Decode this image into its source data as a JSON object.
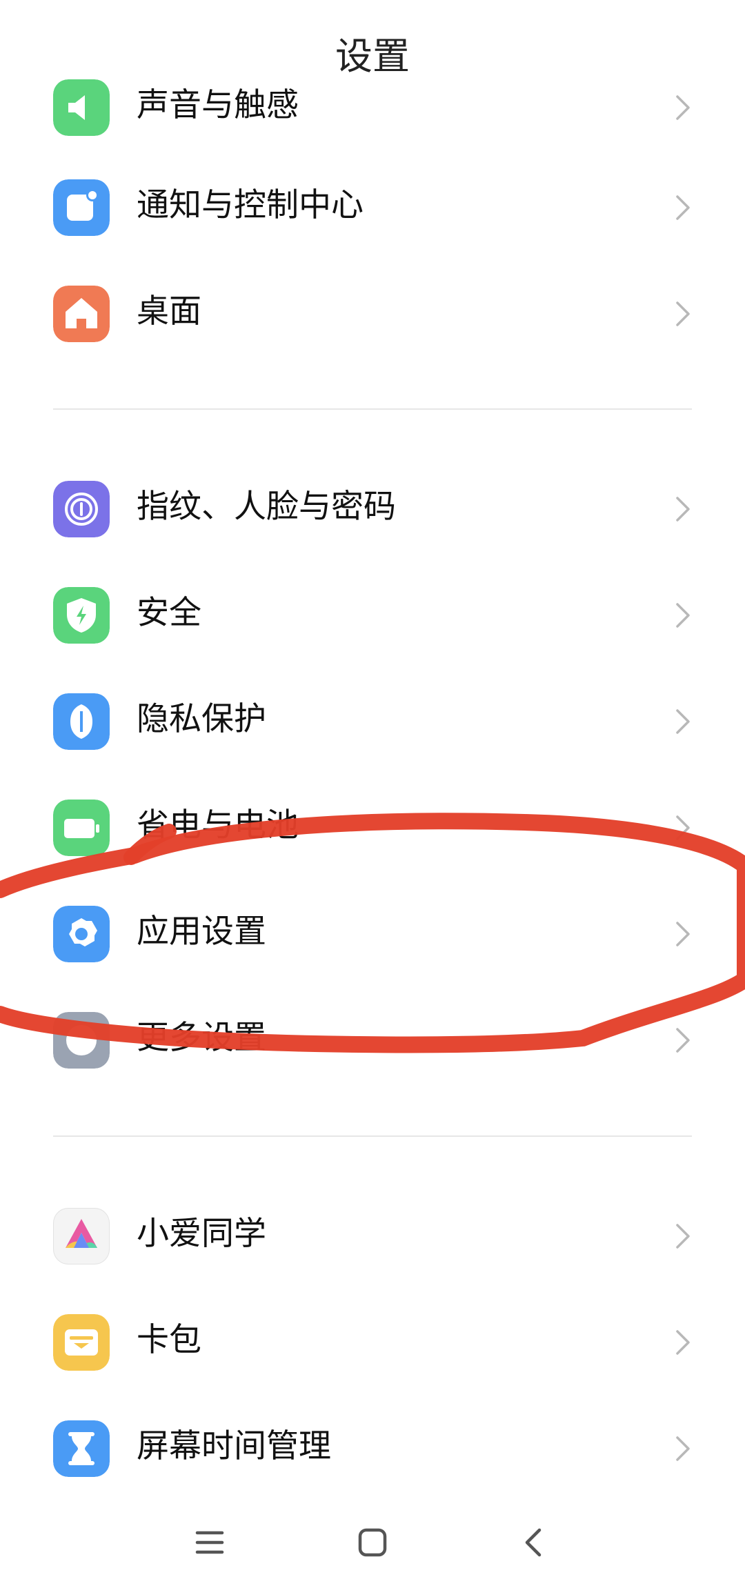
{
  "header": {
    "title": "设置"
  },
  "sections": [
    {
      "items": [
        {
          "id": "sound",
          "label": "声音与触感",
          "icon": "sound-icon",
          "color": "#5ad47c"
        },
        {
          "id": "notification",
          "label": "通知与控制中心",
          "icon": "notification-icon",
          "color": "#4a9bf5"
        },
        {
          "id": "desktop",
          "label": "桌面",
          "icon": "home-icon",
          "color": "#f07a54"
        }
      ]
    },
    {
      "items": [
        {
          "id": "fingerprint",
          "label": "指纹、人脸与密码",
          "icon": "fingerprint-icon",
          "color": "#7b72e8"
        },
        {
          "id": "security",
          "label": "安全",
          "icon": "shield-icon",
          "color": "#5ad47c"
        },
        {
          "id": "privacy",
          "label": "隐私保护",
          "icon": "privacy-icon",
          "color": "#4a9bf5"
        },
        {
          "id": "battery",
          "label": "省电与电池",
          "icon": "battery-icon",
          "color": "#5ad47c"
        },
        {
          "id": "app_settings",
          "label": "应用设置",
          "icon": "gear-icon",
          "color": "#4a9bf5"
        },
        {
          "id": "more_settings",
          "label": "更多设置",
          "icon": "more-settings-icon",
          "color": "#9aa3b2"
        }
      ]
    },
    {
      "items": [
        {
          "id": "xiaoai",
          "label": "小爱同学",
          "icon": "xiaoai-icon",
          "color": "#f4f4f4"
        },
        {
          "id": "wallet",
          "label": "卡包",
          "icon": "wallet-icon",
          "color": "#f6c64e"
        },
        {
          "id": "screen_time",
          "label": "屏幕时间管理",
          "icon": "hourglass-icon",
          "color": "#4a9bf5"
        }
      ]
    }
  ],
  "nav": {
    "menu_icon": "menu-icon",
    "home_icon": "home-square-icon",
    "back_icon": "back-icon"
  },
  "annotation_color": "#e3402a"
}
